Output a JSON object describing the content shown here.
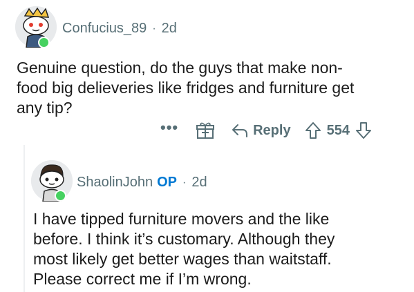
{
  "comment": {
    "username": "Confucius_89",
    "separator": "·",
    "age": "2d",
    "text": "Genuine question, do the guys that make non-food big delieveries like fridges and furniture get any tip?",
    "lines": [
      "Genuine question, do the guys that make non-",
      "food big delieveries like fridges and furniture get",
      "any tip?"
    ],
    "actions": {
      "more_label": "•••",
      "award_icon": "gift-icon",
      "reply_label": "Reply",
      "vote_count": "554"
    }
  },
  "reply": {
    "username": "ShaolinJohn",
    "op_badge": "OP",
    "separator": "·",
    "age": "2d",
    "lines": [
      "I have tipped furniture movers and the like",
      "before. I think it’s customary. Although they",
      "most likely get better wages than waitstaff.",
      "Please correct me if I’m wrong."
    ]
  },
  "colors": {
    "accent": "#0079d3",
    "muted": "#576f76",
    "online": "#46d160",
    "text": "#1c1c1c"
  }
}
